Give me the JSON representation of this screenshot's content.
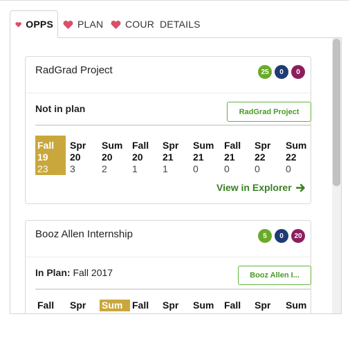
{
  "tabs": [
    {
      "label": "OPPS",
      "active": true,
      "icon": "heart-icon"
    },
    {
      "label": "PLAN",
      "active": false,
      "icon": "heart-icon"
    },
    {
      "label": "COUR",
      "active": false,
      "icon": "heart-icon"
    },
    {
      "label": "DETAILS",
      "active": false
    }
  ],
  "colors": {
    "heart": "#d9506a",
    "highlight": "#c9a73c",
    "green_badge": "#6aaa2a",
    "blue_badge": "#1f3b74",
    "purple_badge": "#8b1f5e",
    "button_green": "#62b33a"
  },
  "cards": [
    {
      "title": "RadGrad Project",
      "badges": [
        "25",
        "0",
        "0"
      ],
      "status_label": "Not in plan",
      "status_value": "",
      "button_label": "RadGrad Project",
      "semesters": [
        {
          "term": "Fall",
          "year": "19",
          "count": "23",
          "highlight": true
        },
        {
          "term": "Spr",
          "year": "20",
          "count": "3"
        },
        {
          "term": "Sum",
          "year": "20",
          "count": "2"
        },
        {
          "term": "Fall",
          "year": "20",
          "count": "1"
        },
        {
          "term": "Spr",
          "year": "21",
          "count": "1"
        },
        {
          "term": "Sum",
          "year": "21",
          "count": "0"
        },
        {
          "term": "Fall",
          "year": "21",
          "count": "0"
        },
        {
          "term": "Spr",
          "year": "22",
          "count": "0"
        },
        {
          "term": "Sum",
          "year": "22",
          "count": "0"
        }
      ],
      "link_label": "View in Explorer"
    },
    {
      "title": "Booz Allen Internship",
      "badges": [
        "5",
        "0",
        "20"
      ],
      "status_label": "In Plan:",
      "status_value": "Fall 2017",
      "button_label": "Booz Allen I...",
      "semesters": [
        {
          "term": "Fall"
        },
        {
          "term": "Spr"
        },
        {
          "term": "Sum",
          "highlight": true
        },
        {
          "term": "Fall"
        },
        {
          "term": "Spr"
        },
        {
          "term": "Sum"
        },
        {
          "term": "Fall"
        },
        {
          "term": "Spr"
        },
        {
          "term": "Sum"
        }
      ]
    }
  ]
}
